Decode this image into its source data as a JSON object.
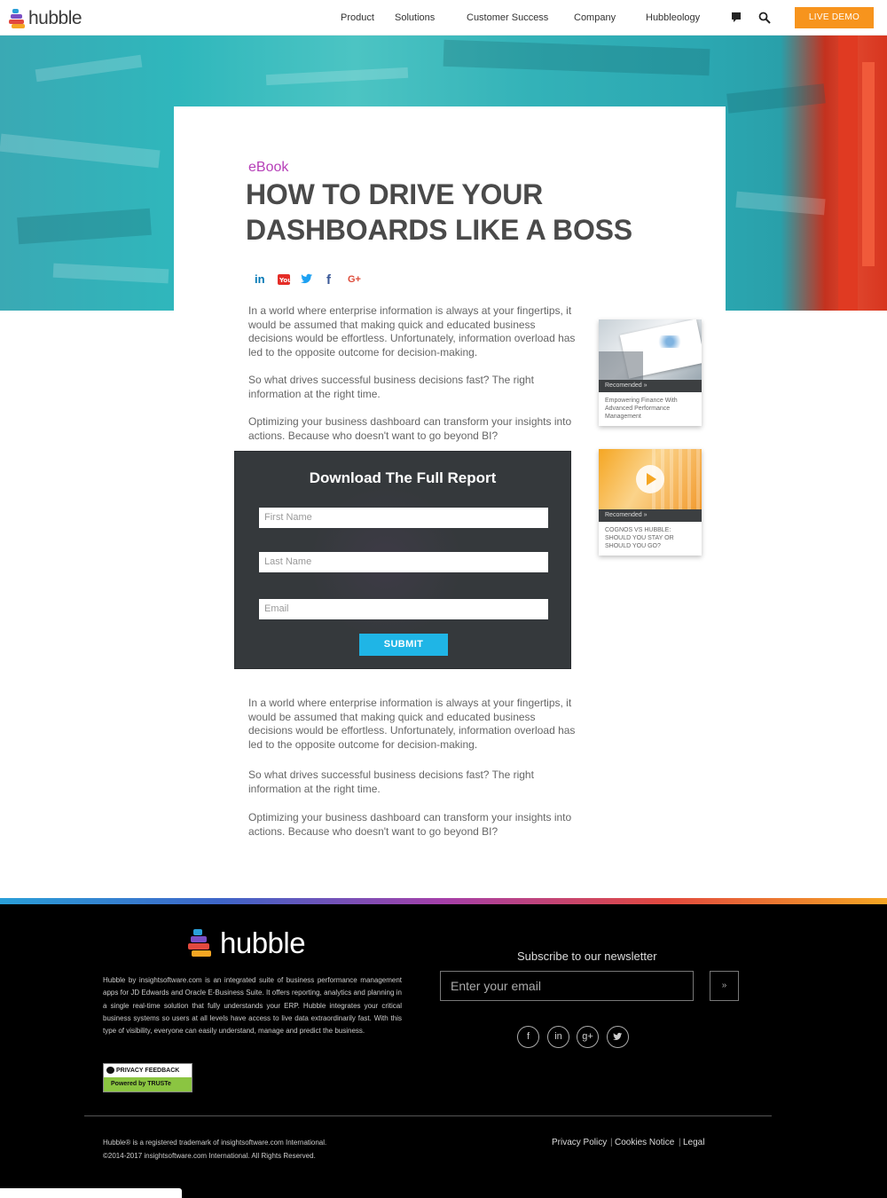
{
  "nav": {
    "brand": "hubble",
    "items": [
      "Product",
      "Solutions",
      "Customer Success",
      "Company",
      "Hubbleology"
    ],
    "live_demo": "LIVE DEMO",
    "chat_icon": "chat-icon",
    "search_icon": "search-icon"
  },
  "hero": {
    "tag": "eBook",
    "title": "HOW TO DRIVE YOUR DASHBOARDS LIKE A BOSS",
    "share_icons": [
      "linkedin-icon",
      "youtube-icon",
      "twitter-icon",
      "facebook-icon",
      "google-plus-icon"
    ],
    "share_glyphs": [
      "in",
      "▶",
      "🐦",
      "f",
      "G+"
    ],
    "colors": {
      "tag": "#b63fb8",
      "title": "#4a4a4a",
      "linkedin": "#0077b5",
      "youtube": "#e52d27",
      "twitter": "#1da1f2",
      "facebook": "#3b5998",
      "gplus": "#dd4b39"
    }
  },
  "intro": {
    "p1": "In a world where enterprise information is always at your fingertips, it would be assumed that making quick and educated business decisions would be effortless. Unfortunately, information overload has led to the opposite outcome for decision-making.",
    "p2": "So what drives successful business decisions fast? The right information at the right time.",
    "p3": "Optimizing your business dashboard can transform your insights into actions. Because who doesn't want to go beyond BI?"
  },
  "form": {
    "title": "Download The Full Report",
    "first_name_placeholder": "First Name",
    "last_name_placeholder": "Last Name",
    "email_placeholder": "Email",
    "submit": "SUBMIT"
  },
  "sidebar": [
    {
      "rec": "Recomended »",
      "caption": "Empowering Finance With Advanced Performance Management"
    },
    {
      "rec": "Recomended »",
      "caption": "COGNOS VS HUBBLE: SHOULD YOU STAY OR SHOULD YOU GO?"
    }
  ],
  "outro": {
    "p1": "In a world where enterprise information is always at your fingertips, it would be assumed that making quick and educated business decisions would be effortless. Unfortunately, information overload has led to the opposite outcome for decision-making.",
    "p2": "So what drives successful business decisions fast? The right information at the right time.",
    "p3": "Optimizing your business dashboard can transform your insights into actions. Because who doesn't want to go beyond BI?"
  },
  "footer": {
    "brand": "hubble",
    "about": "Hubble by insightsoftware.com is an integrated suite of business performance management apps for JD Edwards and Oracle E-Business Suite. It offers reporting, analytics and planning in a single real-time solution that fully understands your ERP. Hubble integrates your critical business systems so users at all levels have access to live data extraordinarily fast. With this type of visibility, everyone can easily understand, manage and predict the business.",
    "truste_top": "PRIVACY FEEDBACK",
    "truste_bottom": "Powered by TRUSTe",
    "subscribe_label": "Subscribe to our newsletter",
    "email_placeholder": "Enter your email",
    "go": "»",
    "social_icons": [
      "facebook-icon",
      "linkedin-icon",
      "google-plus-icon",
      "twitter-icon"
    ],
    "social_glyphs": [
      "f",
      "in",
      "g+",
      "t"
    ],
    "legal1": "Hubble® is a registered trademark of insightsoftware.com International.",
    "legal2": "©2014-2017 insightsoftware.com International. All Rights Reserved.",
    "links": [
      "Privacy Policy",
      "Cookies Notice",
      "Legal"
    ],
    "gradient": [
      "#2a9fd8",
      "#3f65c8",
      "#a540a9",
      "#e2493f",
      "#f5a623"
    ]
  }
}
